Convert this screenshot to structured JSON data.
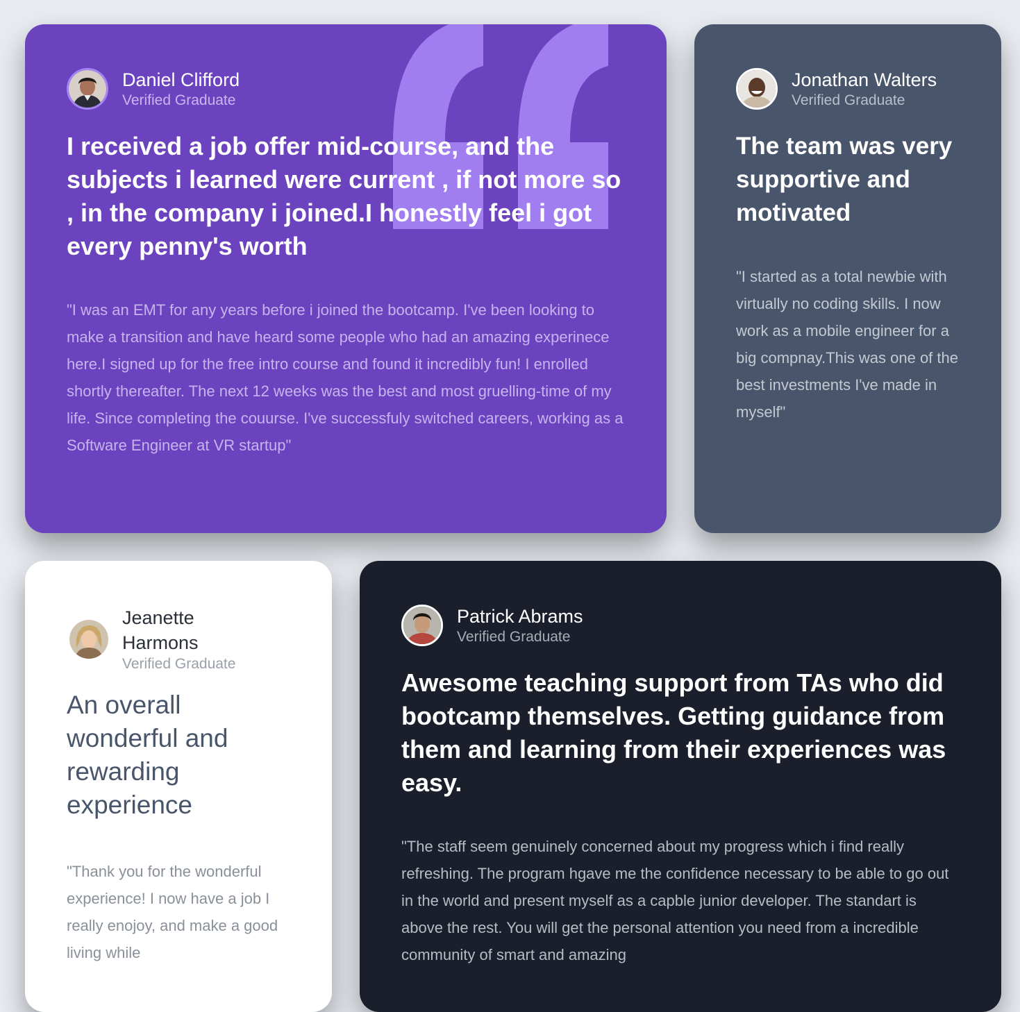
{
  "testimonials": [
    {
      "name": "Daniel Clifford",
      "role": "Verified Graduate",
      "avatar_icon": "avatar-daniel",
      "headline": "I received a job offer mid-course, and the subjects i learned were current , if not more so , in the company i joined.I honestly feel i got every penny's worth",
      "quote": "\"I was an EMT for any years before i joined the bootcamp. I've been looking to make a transition and have heard some people who had an amazing experinece here.I signed up for the free intro course and found it incredibly fun! I enrolled shortly thereafter. The next 12 weeks was the best and most gruelling-time of my life. Since completing the couurse. I've successfuly switched careers, working as a Software Engineer at VR startup\"",
      "background": "#6c43bf"
    },
    {
      "name": "Jonathan Walters",
      "role": "Verified Graduate",
      "avatar_icon": "avatar-jonathan",
      "headline": "The team was very supportive and motivated",
      "quote": "\"I started as a total newbie with virtually no coding skills. I now work as a mobile engineer for a big compnay.This was one of the best investments I've made in myself\"",
      "background": "#48556a"
    },
    {
      "name": "Jeanette Harmons",
      "role": "Verified Graduate",
      "avatar_icon": "avatar-jeanette",
      "headline": "An overall wonderful and rewarding experience",
      "quote": "\"Thank you for the wonderful experience! I now have a job I really enojoy, and make a good living while",
      "background": "#ffffff"
    },
    {
      "name": "Patrick Abrams",
      "role": "Verified Graduate",
      "avatar_icon": "avatar-patrick",
      "headline": "Awesome teaching support from TAs who did bootcamp themselves. Getting guidance from them and learning from their experiences was easy.",
      "quote": "\"The staff seem genuinely concerned about my progress which i find really refreshing. The program hgave me the confidence necessary to be able to go out in the world and present myself as a capble junior developer. The standart is above the rest. You will get the personal attention you need from a incredible community of smart and amazing",
      "background": "#1a1f2b"
    }
  ],
  "decoration": {
    "quote_icon": "quotation-mark-icon",
    "quote_color": "#a07ef0"
  }
}
